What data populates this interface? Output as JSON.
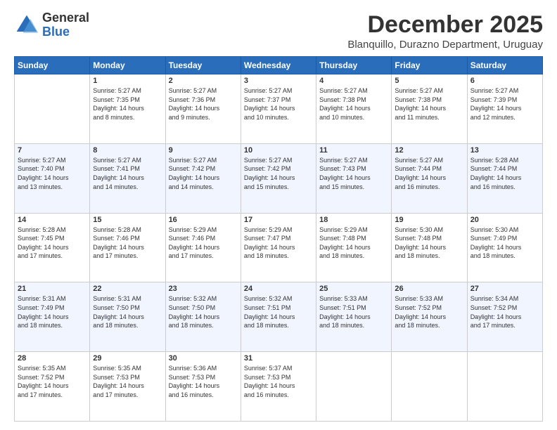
{
  "logo": {
    "general": "General",
    "blue": "Blue"
  },
  "header": {
    "month": "December 2025",
    "location": "Blanquillo, Durazno Department, Uruguay"
  },
  "days_of_week": [
    "Sunday",
    "Monday",
    "Tuesday",
    "Wednesday",
    "Thursday",
    "Friday",
    "Saturday"
  ],
  "weeks": [
    [
      {
        "day": "",
        "info": ""
      },
      {
        "day": "1",
        "info": "Sunrise: 5:27 AM\nSunset: 7:35 PM\nDaylight: 14 hours\nand 8 minutes."
      },
      {
        "day": "2",
        "info": "Sunrise: 5:27 AM\nSunset: 7:36 PM\nDaylight: 14 hours\nand 9 minutes."
      },
      {
        "day": "3",
        "info": "Sunrise: 5:27 AM\nSunset: 7:37 PM\nDaylight: 14 hours\nand 10 minutes."
      },
      {
        "day": "4",
        "info": "Sunrise: 5:27 AM\nSunset: 7:38 PM\nDaylight: 14 hours\nand 10 minutes."
      },
      {
        "day": "5",
        "info": "Sunrise: 5:27 AM\nSunset: 7:38 PM\nDaylight: 14 hours\nand 11 minutes."
      },
      {
        "day": "6",
        "info": "Sunrise: 5:27 AM\nSunset: 7:39 PM\nDaylight: 14 hours\nand 12 minutes."
      }
    ],
    [
      {
        "day": "7",
        "info": "Sunrise: 5:27 AM\nSunset: 7:40 PM\nDaylight: 14 hours\nand 13 minutes."
      },
      {
        "day": "8",
        "info": "Sunrise: 5:27 AM\nSunset: 7:41 PM\nDaylight: 14 hours\nand 14 minutes."
      },
      {
        "day": "9",
        "info": "Sunrise: 5:27 AM\nSunset: 7:42 PM\nDaylight: 14 hours\nand 14 minutes."
      },
      {
        "day": "10",
        "info": "Sunrise: 5:27 AM\nSunset: 7:42 PM\nDaylight: 14 hours\nand 15 minutes."
      },
      {
        "day": "11",
        "info": "Sunrise: 5:27 AM\nSunset: 7:43 PM\nDaylight: 14 hours\nand 15 minutes."
      },
      {
        "day": "12",
        "info": "Sunrise: 5:27 AM\nSunset: 7:44 PM\nDaylight: 14 hours\nand 16 minutes."
      },
      {
        "day": "13",
        "info": "Sunrise: 5:28 AM\nSunset: 7:44 PM\nDaylight: 14 hours\nand 16 minutes."
      }
    ],
    [
      {
        "day": "14",
        "info": "Sunrise: 5:28 AM\nSunset: 7:45 PM\nDaylight: 14 hours\nand 17 minutes."
      },
      {
        "day": "15",
        "info": "Sunrise: 5:28 AM\nSunset: 7:46 PM\nDaylight: 14 hours\nand 17 minutes."
      },
      {
        "day": "16",
        "info": "Sunrise: 5:29 AM\nSunset: 7:46 PM\nDaylight: 14 hours\nand 17 minutes."
      },
      {
        "day": "17",
        "info": "Sunrise: 5:29 AM\nSunset: 7:47 PM\nDaylight: 14 hours\nand 18 minutes."
      },
      {
        "day": "18",
        "info": "Sunrise: 5:29 AM\nSunset: 7:48 PM\nDaylight: 14 hours\nand 18 minutes."
      },
      {
        "day": "19",
        "info": "Sunrise: 5:30 AM\nSunset: 7:48 PM\nDaylight: 14 hours\nand 18 minutes."
      },
      {
        "day": "20",
        "info": "Sunrise: 5:30 AM\nSunset: 7:49 PM\nDaylight: 14 hours\nand 18 minutes."
      }
    ],
    [
      {
        "day": "21",
        "info": "Sunrise: 5:31 AM\nSunset: 7:49 PM\nDaylight: 14 hours\nand 18 minutes."
      },
      {
        "day": "22",
        "info": "Sunrise: 5:31 AM\nSunset: 7:50 PM\nDaylight: 14 hours\nand 18 minutes."
      },
      {
        "day": "23",
        "info": "Sunrise: 5:32 AM\nSunset: 7:50 PM\nDaylight: 14 hours\nand 18 minutes."
      },
      {
        "day": "24",
        "info": "Sunrise: 5:32 AM\nSunset: 7:51 PM\nDaylight: 14 hours\nand 18 minutes."
      },
      {
        "day": "25",
        "info": "Sunrise: 5:33 AM\nSunset: 7:51 PM\nDaylight: 14 hours\nand 18 minutes."
      },
      {
        "day": "26",
        "info": "Sunrise: 5:33 AM\nSunset: 7:52 PM\nDaylight: 14 hours\nand 18 minutes."
      },
      {
        "day": "27",
        "info": "Sunrise: 5:34 AM\nSunset: 7:52 PM\nDaylight: 14 hours\nand 17 minutes."
      }
    ],
    [
      {
        "day": "28",
        "info": "Sunrise: 5:35 AM\nSunset: 7:52 PM\nDaylight: 14 hours\nand 17 minutes."
      },
      {
        "day": "29",
        "info": "Sunrise: 5:35 AM\nSunset: 7:53 PM\nDaylight: 14 hours\nand 17 minutes."
      },
      {
        "day": "30",
        "info": "Sunrise: 5:36 AM\nSunset: 7:53 PM\nDaylight: 14 hours\nand 16 minutes."
      },
      {
        "day": "31",
        "info": "Sunrise: 5:37 AM\nSunset: 7:53 PM\nDaylight: 14 hours\nand 16 minutes."
      },
      {
        "day": "",
        "info": ""
      },
      {
        "day": "",
        "info": ""
      },
      {
        "day": "",
        "info": ""
      }
    ]
  ]
}
